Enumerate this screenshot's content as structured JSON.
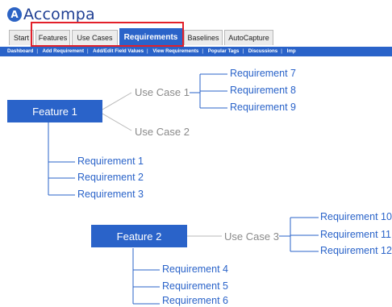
{
  "app": {
    "logo_mark": "A",
    "logo_text": "Accompa"
  },
  "tabs": [
    {
      "label": "Start"
    },
    {
      "label": "Features"
    },
    {
      "label": "Use Cases"
    },
    {
      "label": "Requirements",
      "active": true
    },
    {
      "label": "Baselines"
    },
    {
      "label": "AutoCapture"
    }
  ],
  "subnav": [
    "Dashboard",
    "Add Requirement",
    "Add/Edit Field Values",
    "View Requirements",
    "Popular Tags",
    "Discussions",
    "Imp"
  ],
  "diagram": {
    "feature1": {
      "label": "Feature 1",
      "use_cases": [
        {
          "label": "Use Case 1",
          "requirements": [
            "Requirement 7",
            "Requirement 8",
            "Requirement 9"
          ]
        },
        {
          "label": "Use Case 2",
          "requirements": []
        }
      ],
      "requirements": [
        "Requirement 1",
        "Requirement 2",
        "Requirement 3"
      ]
    },
    "feature2": {
      "label": "Feature 2",
      "use_cases": [
        {
          "label": "Use Case 3",
          "requirements": [
            "Requirement 10",
            "Requirement 11",
            "Requirement 12"
          ]
        }
      ],
      "requirements": [
        "Requirement 4",
        "Requirement 5",
        "Requirement 6"
      ]
    }
  },
  "colors": {
    "brand_blue": "#2a63c9",
    "highlight_red": "#e2202a",
    "muted_gray": "#8a8a8a"
  }
}
